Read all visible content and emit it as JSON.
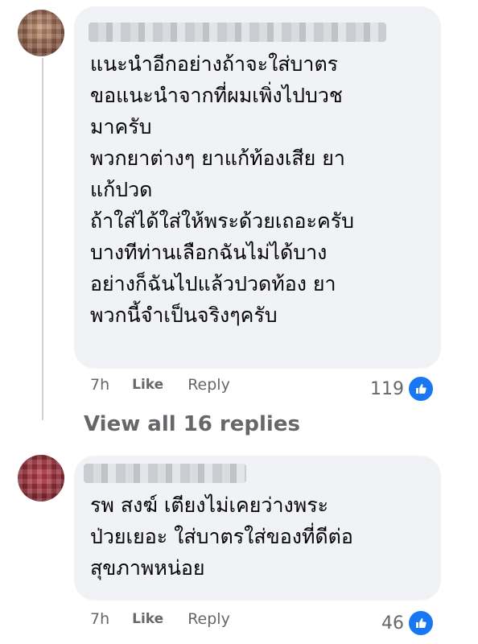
{
  "comments": [
    {
      "text": "แนะนำอีกอย่างถ้าจะใส่บาตร\nขอแนะนำจากที่ผมเพิ่งไปบวช\nมาครับ\nพวกยาต่างๆ ยาแก้ท้องเสีย ยา\nแก้ปวด\nถ้าใส่ได้ใส่ให้พระด้วยเถอะครับ\nบางทีท่านเลือกฉันไม่ได้บาง\nอย่างก็ฉันไปแล้วปวดท้อง ยา\nพวกนี้จำเป็นจริงๆครับ",
      "time": "7h",
      "like_label": "Like",
      "reply_label": "Reply",
      "reaction_count": "119",
      "reaction_icon": "like-icon"
    },
    {
      "text": "รพ สงฆ์ เตียงไม่เคยว่างพระ\nป่วยเยอะ ใส่บาตรใส่ของที่ดีต่อ\nสุขภาพหน่อย",
      "time": "7h",
      "like_label": "Like",
      "reply_label": "Reply",
      "reaction_count": "46",
      "reaction_icon": "like-icon"
    }
  ],
  "view_replies_label": "View all 16 replies",
  "colors": {
    "bubble": "#f0f2f5",
    "text": "#050505",
    "meta": "#65676b",
    "like_badge": "#1877f2"
  }
}
